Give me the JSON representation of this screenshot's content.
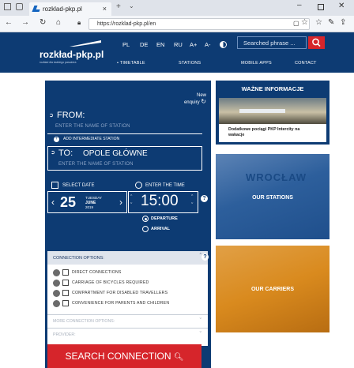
{
  "browser": {
    "tab_title": "rozklad-pkp.pl",
    "tab_close": "×",
    "new_tab": "+",
    "url": "https://rozklad-pkp.pl/en"
  },
  "header": {
    "logo_name": "rozkład-pkp.pl",
    "logo_tagline": "rozkład dla każdego pasażera",
    "languages": [
      "PL",
      "DE",
      "EN",
      "RU"
    ],
    "font_controls": [
      "A+",
      "A-"
    ],
    "search_placeholder": "Searched phrase ...",
    "nav": [
      "TIMETABLE",
      "STATIONS",
      "MOBILE APPS",
      "CONTACT"
    ]
  },
  "form": {
    "new_enquiry_1": "New",
    "new_enquiry_2": "enquiry",
    "from_label": "FROM:",
    "from_placeholder": "ENTER THE NAME OF STATION",
    "add_intermediate": "ADD INTERMEDIATE STATION",
    "to_label": "TO:",
    "to_value": "OPOLE GŁÓWNE",
    "to_placeholder": "ENTER THE NAME OF STATION",
    "select_date_label": "SELECT DATE",
    "date_day": "25",
    "date_weekday": "TUESDAY",
    "date_month": "JUNE",
    "date_year": "2019",
    "enter_time_label": "ENTER THE TIME",
    "time_value": "15:00",
    "help": "?",
    "departure": "DEPARTURE",
    "arrival": "ARRIVAL"
  },
  "options": {
    "header": "CONNECTION OPTIONS:",
    "items": [
      "DIRECT CONNECTIONS",
      "CARRIAGE OF BICYCLES REQUIRED",
      "COMPARTMENT FOR DISABLED TRAVELLERS",
      "CONVENIENCE FOR PARENTS AND CHILDREN"
    ],
    "more": "MORE CONNECTION OPTIONS:",
    "provider": "PROVIDER:"
  },
  "search_button": "SEARCH CONNECTION",
  "cards": {
    "info_title": "WAŻNE INFORMACJE",
    "info_caption": "Dodatkowe pociągi PKP Intercity na wakacje",
    "stations": "OUR STATIONS",
    "stations_sign": "WROCŁAW",
    "carriers": "OUR CARRIERS"
  },
  "colors": {
    "brand_navy": "#0d3b73",
    "accent_red": "#d6252b",
    "stations_blue": "#2d5f9c",
    "carriers_orange": "#d98a1e"
  }
}
